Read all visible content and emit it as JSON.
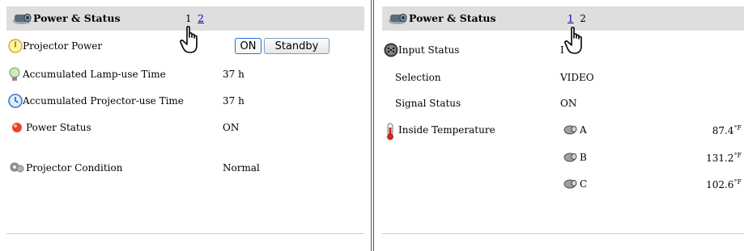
{
  "left": {
    "header": {
      "title": "Power & Status",
      "page1": "1",
      "page2": "2",
      "current_page": "1"
    },
    "rows": {
      "projector_power": {
        "label": "Projector Power",
        "on_button": "ON",
        "standby_button": "Standby"
      },
      "lamp_time": {
        "label": "Accumulated Lamp-use Time",
        "value": "37 h"
      },
      "projector_time": {
        "label": "Accumulated Projector-use Time",
        "value": "37 h"
      },
      "power_status": {
        "label": "Power Status",
        "value": "ON"
      },
      "condition": {
        "label": "Projector Condition",
        "value": "Normal"
      }
    }
  },
  "right": {
    "header": {
      "title": "Power & Status",
      "page1": "1",
      "page2": "2",
      "current_page": "2"
    },
    "rows": {
      "input_status": {
        "label": "Input Status",
        "value": "I"
      },
      "selection": {
        "label": "Selection",
        "value": "VIDEO"
      },
      "signal_status": {
        "label": "Signal Status",
        "value": "ON"
      },
      "inside_temp": {
        "label": "Inside Temperature",
        "sensors": [
          {
            "name": "A",
            "value": "87.4",
            "unit": "°F"
          },
          {
            "name": "B",
            "value": "131.2",
            "unit": "°F"
          },
          {
            "name": "C",
            "value": "102.6",
            "unit": "°F"
          }
        ]
      }
    }
  },
  "icons": {
    "projector": "projector-icon",
    "power": "power-icon",
    "lamp": "lamp-icon",
    "clock": "clock-icon",
    "status": "status-dot-icon",
    "condition": "condition-icon",
    "input": "input-connector-icon",
    "thermometer": "thermometer-icon",
    "sensor": "sensor-icon",
    "cursor": "hand-pointer-icon"
  },
  "colors": {
    "header_bg": "#dedede",
    "link": "#0000cc",
    "button_border": "#7f9db9"
  }
}
